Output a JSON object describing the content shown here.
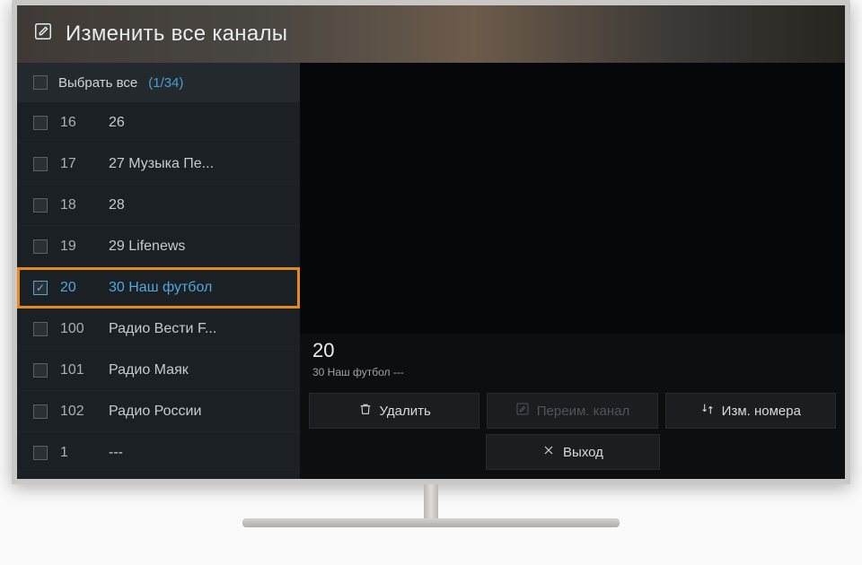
{
  "header": {
    "title": "Изменить все каналы"
  },
  "sidebar": {
    "selectAllLabel": "Выбрать все",
    "selectCount": "(1/34)",
    "channels": [
      {
        "num": "16",
        "name": "26",
        "checked": false,
        "selected": false
      },
      {
        "num": "17",
        "name": "27 Музыка Пе...",
        "checked": false,
        "selected": false
      },
      {
        "num": "18",
        "name": "28",
        "checked": false,
        "selected": false
      },
      {
        "num": "19",
        "name": "29 Lifenews",
        "checked": false,
        "selected": false
      },
      {
        "num": "20",
        "name": "30 Наш футбол",
        "checked": true,
        "selected": true
      },
      {
        "num": "100",
        "name": "Радио Вести F...",
        "checked": false,
        "selected": false
      },
      {
        "num": "101",
        "name": "Радио Маяк",
        "checked": false,
        "selected": false
      },
      {
        "num": "102",
        "name": "Радио России",
        "checked": false,
        "selected": false
      },
      {
        "num": "1",
        "name": "---",
        "checked": false,
        "selected": false
      }
    ]
  },
  "detail": {
    "number": "20",
    "name": "30 Наш футбол ---"
  },
  "buttons": {
    "delete": "Удалить",
    "rename": "Переим. канал",
    "renumber": "Изм. номера",
    "exit": "Выход"
  }
}
